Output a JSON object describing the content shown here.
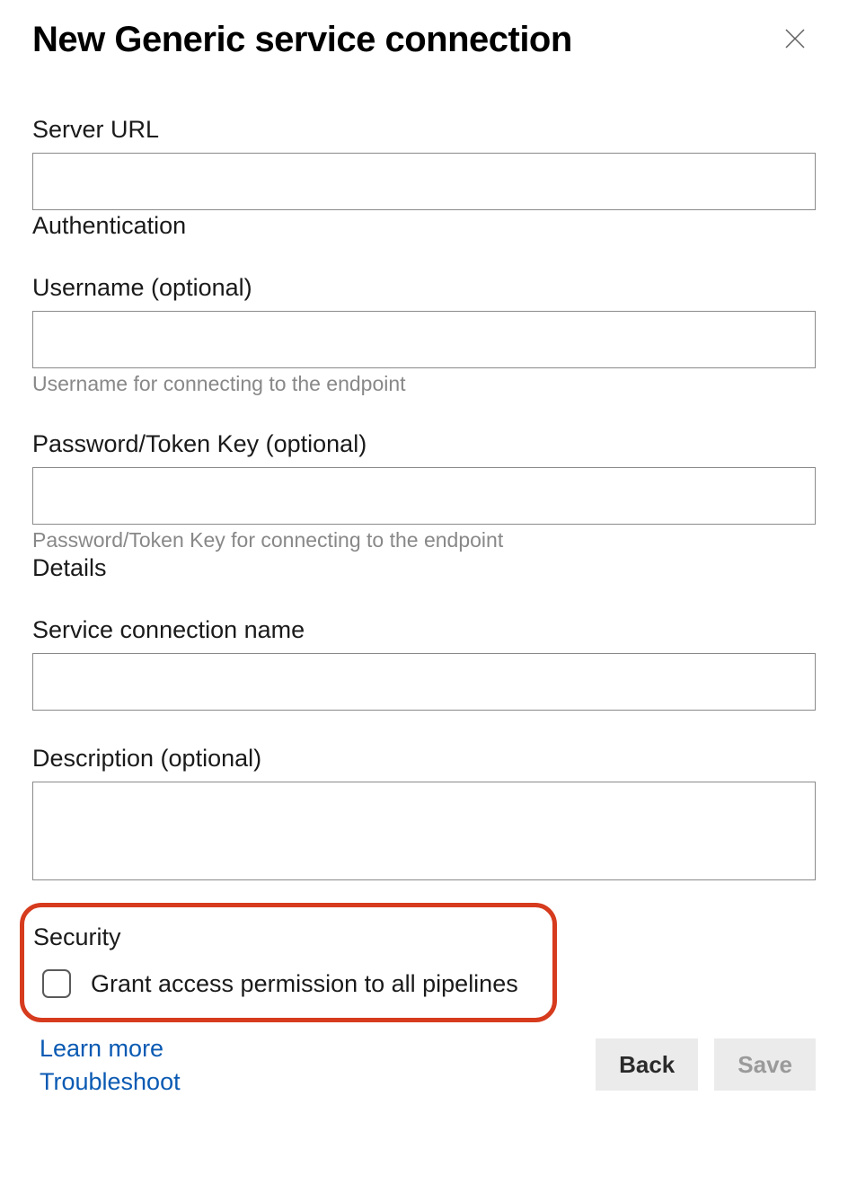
{
  "dialog": {
    "title": "New Generic service connection"
  },
  "fields": {
    "server_url": {
      "label": "Server URL",
      "value": ""
    },
    "auth_heading": "Authentication",
    "username": {
      "label": "Username (optional)",
      "value": "",
      "help": "Username for connecting to the endpoint"
    },
    "password": {
      "label": "Password/Token Key (optional)",
      "value": "",
      "help": "Password/Token Key for connecting to the endpoint"
    },
    "details_heading": "Details",
    "conn_name": {
      "label": "Service connection name",
      "value": ""
    },
    "description": {
      "label": "Description (optional)",
      "value": ""
    }
  },
  "security": {
    "heading": "Security",
    "grant_label": "Grant access permission to all pipelines",
    "grant_checked": false
  },
  "footer": {
    "learn_more": "Learn more",
    "troubleshoot": "Troubleshoot",
    "back": "Back",
    "save": "Save"
  }
}
